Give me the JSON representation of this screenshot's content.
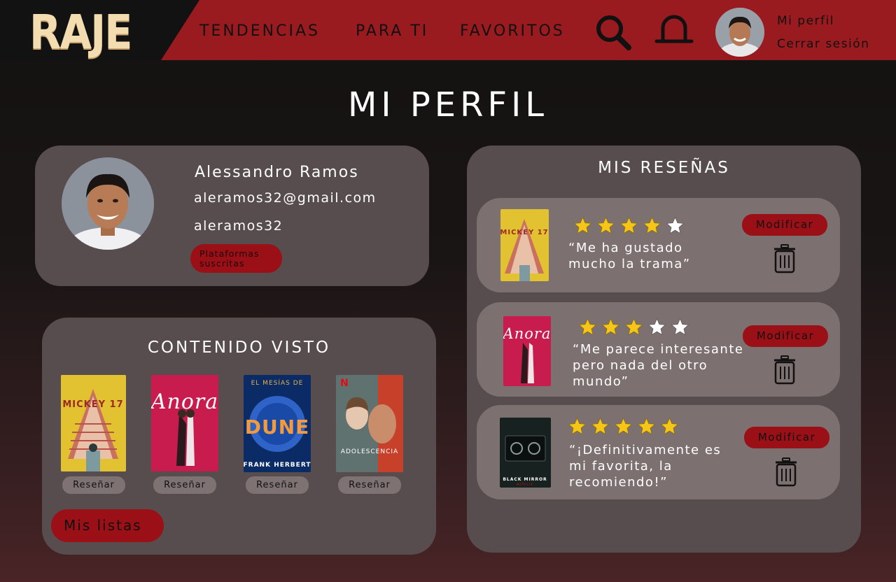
{
  "header": {
    "logo": "RAJE",
    "nav": [
      "TENDENCIAS",
      "PARA TI",
      "FAVORITOS"
    ],
    "links": {
      "profile": "Mi perfil",
      "logout": "Cerrar sesión"
    },
    "icons": [
      "search-icon",
      "notification-bell-icon"
    ]
  },
  "page": {
    "title": "MI PERFIL"
  },
  "profile": {
    "name": "Alessandro Ramos",
    "email": "aleramos32@gmail.com",
    "username": "aleramos32",
    "platforms_button": "Plataformas suscritas"
  },
  "seen": {
    "title": "CONTENIDO VISTO",
    "items": [
      {
        "poster_text": "MICKEY 17",
        "button": "Reseñar"
      },
      {
        "poster_text": "Anora",
        "button": "Reseñar"
      },
      {
        "poster_text": "DUNE",
        "poster_top": "EL MESÍAS DE",
        "poster_bottom": "FRANK HERBERT",
        "button": "Reseñar"
      },
      {
        "poster_text": "ADOLESCENCIA",
        "button": "Reseñar"
      }
    ],
    "lists_button": "Mis listas"
  },
  "reviews": {
    "title": "MIS RESEÑAS",
    "items": [
      {
        "poster_text": "MICKEY 17",
        "rating": 4,
        "max_rating": 5,
        "text": "“Me ha gustado mucho la trama”",
        "modify": "Modificar"
      },
      {
        "poster_text": "Anora",
        "rating": 3,
        "max_rating": 5,
        "text": "“Me parece interesante pero nada del otro mundo”",
        "modify": "Modificar"
      },
      {
        "poster_text": "BLACK MIRROR",
        "rating": 5,
        "max_rating": 5,
        "text": "“¡Definitivamente es mi favorita, la recomiendo!”",
        "modify": "Modificar"
      }
    ]
  },
  "colors": {
    "accent_red": "#9a1b1f",
    "button_red": "#9a1016",
    "card": "#574d4e",
    "review_card": "#7d7071",
    "star_filled": "#f5c518",
    "logo_cream": "#f3dcb0"
  }
}
